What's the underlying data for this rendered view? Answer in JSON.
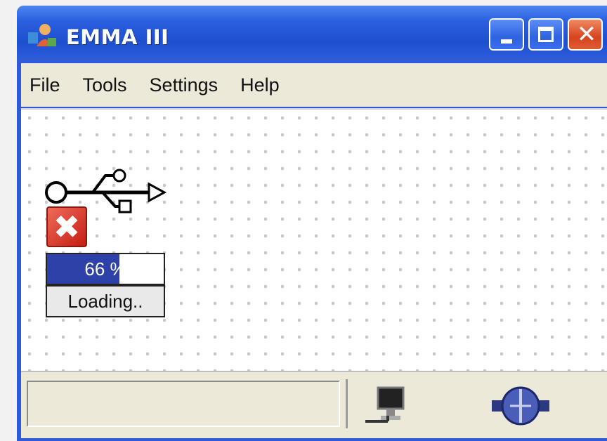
{
  "window": {
    "title": "EMMA III",
    "icon": "app-user-icon",
    "controls": {
      "minimize": "minimize-icon",
      "maximize": "maximize-icon",
      "close": "close-icon"
    }
  },
  "menu": {
    "items": [
      {
        "label": "File"
      },
      {
        "label": "Tools"
      },
      {
        "label": "Settings"
      },
      {
        "label": "Help"
      }
    ]
  },
  "device": {
    "usb_icon": "usb-icon",
    "error_icon": "error-icon",
    "progress_text": "66 %",
    "progress_value": 0.62,
    "status_text": "Loading.."
  },
  "statusbar": {
    "panel_text": "",
    "icons": [
      "computer-icon",
      "network-connector-icon"
    ]
  },
  "colors": {
    "titlebar": "#2a5fe0",
    "progress_fill": "#2d41a8",
    "close_button": "#d6441f"
  }
}
